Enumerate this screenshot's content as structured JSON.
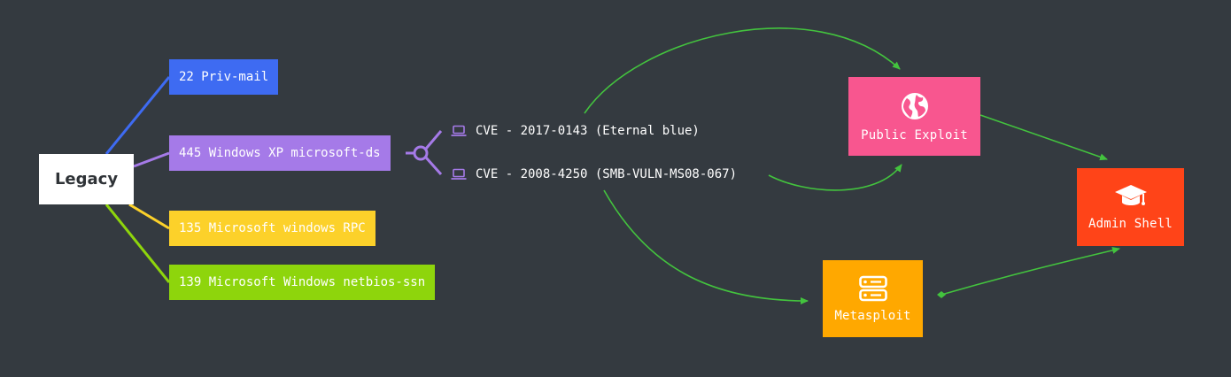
{
  "root": {
    "label": "Legacy"
  },
  "ports": [
    {
      "label": "22 Priv-mail",
      "color": "#3e6bf2"
    },
    {
      "label": "445 Windows XP microsoft-ds",
      "color": "#a57ae8"
    },
    {
      "label": "135 Microsoft windows RPC",
      "color": "#fcd12a"
    },
    {
      "label": "139 Microsoft Windows netbios-ssn",
      "color": "#8ed50c"
    }
  ],
  "cves": [
    {
      "label": "CVE - 2017-0143 (Eternal blue)",
      "icon": "laptop-icon"
    },
    {
      "label": "CVE - 2008-4250 (SMB-VULN-MS08-067)",
      "icon": "laptop-icon"
    }
  ],
  "targets": {
    "public_exploit": {
      "label": "Public Exploit",
      "color": "#f8568f",
      "icon": "globe-icon"
    },
    "metasploit": {
      "label": "Metasploit",
      "color": "#ffa800",
      "icon": "server-icon"
    },
    "admin_shell": {
      "label": "Admin Shell",
      "color": "#ff4418",
      "icon": "graduation-cap-icon"
    }
  },
  "edge_color": "#43c33e",
  "junction_color": "#a57ae8"
}
